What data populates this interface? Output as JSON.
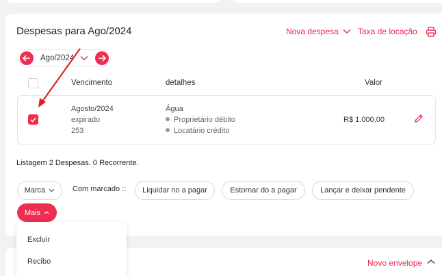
{
  "header": {
    "title": "Despesas para Ago/2024",
    "new_expense": "Nova despesa",
    "rent_fee": "Taxa de locação"
  },
  "month_selector": {
    "value": "Ago/2024"
  },
  "table": {
    "columns": [
      "Vencimento",
      "detalhes",
      "Valor"
    ],
    "rows": [
      {
        "selected": true,
        "due_date": "Agosto/2024",
        "status": "expirado",
        "code": "253",
        "detail": "Água",
        "debit": "Proprietário débito",
        "credit": "Locatário crédito",
        "value": "R$ 1.000,00"
      }
    ]
  },
  "summary": "Listagem 2 Despesas. 0 Recorrente.",
  "actions": {
    "mark": "Marca",
    "with_marked": "Com marcado ::",
    "settle": "Liquidar no a pagar",
    "reverse": "Estornar do a pagar",
    "post_pending": "Lançar e deixar pendente",
    "more": "Mais"
  },
  "more_menu": [
    "Excluir",
    "Recibo"
  ],
  "envelope": {
    "new_envelope": "Novo envelope"
  },
  "colors": {
    "accent": "#ee2e50",
    "annotation_arrow": "#e0201f"
  }
}
